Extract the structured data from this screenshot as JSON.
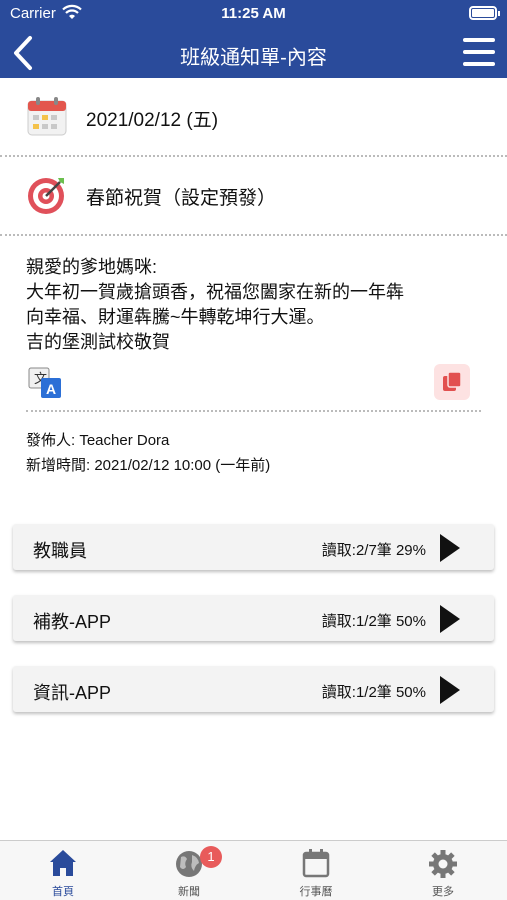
{
  "status_bar": {
    "carrier": "Carrier",
    "time": "11:25 AM"
  },
  "nav": {
    "title": "班級通知單-內容",
    "back_icon": "chevron-left-icon",
    "menu_icon": "hamburger-menu-icon"
  },
  "date_row": {
    "text": "2021/02/12 (五)",
    "icon": "calendar-icon"
  },
  "subject_row": {
    "text": "春節祝賀（設定預發）",
    "icon": "target-icon"
  },
  "message": {
    "lines": [
      "親愛的爹地媽咪:",
      "大年初一賀歲搶頭香，祝福您闔家在新的一年犇",
      "向幸福、財運犇騰~牛轉乾坤行大運。",
      "吉的堡測試校敬賀"
    ],
    "translate_icon": "translate-icon",
    "copy_icon": "copy-icon"
  },
  "meta": {
    "publisher": "發佈人: Teacher Dora",
    "created": "新增時間: 2021/02/12 10:00 (一年前)"
  },
  "groups": [
    {
      "name": "教職員",
      "stat": "讀取:2/7筆 29%"
    },
    {
      "name": "補教-APP",
      "stat": "讀取:1/2筆 50%"
    },
    {
      "name": "資訊-APP",
      "stat": "讀取:1/2筆 50%"
    }
  ],
  "tabs": [
    {
      "label": "首頁",
      "icon": "home-icon",
      "active": true
    },
    {
      "label": "新聞",
      "icon": "globe-icon",
      "badge": "1"
    },
    {
      "label": "行事曆",
      "icon": "calendar-icon"
    },
    {
      "label": "更多",
      "icon": "gear-icon"
    }
  ],
  "colors": {
    "nav_bg": "#2a4b9b",
    "badge": "#e85b5b",
    "copy_bg": "#fde2e2",
    "copy_fg": "#e2504f",
    "target_red": "#e0505a"
  }
}
